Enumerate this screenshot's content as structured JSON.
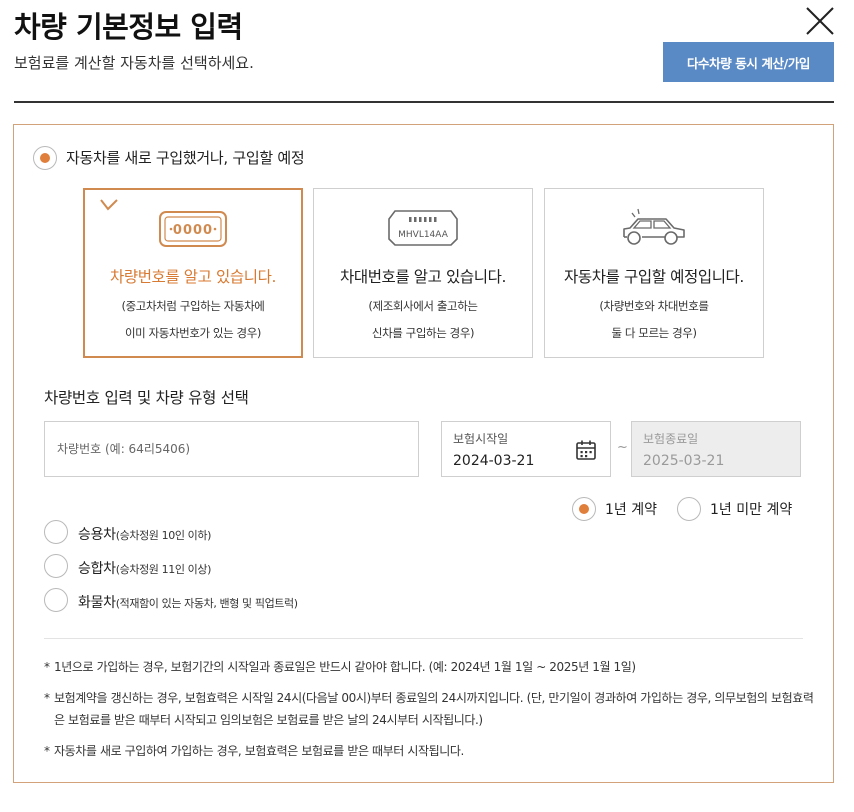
{
  "header": {
    "title": "차량 기본정보 입력",
    "subtitle": "보험료를 계산할 자동차를 선택하세요.",
    "multi_button": "다수차량 동시 계산/가입"
  },
  "purchase_option": {
    "label": "자동차를 새로 구입했거나, 구입할 예정",
    "selected": true
  },
  "cards": [
    {
      "icon": "license-plate-icon",
      "icon_text": "0000",
      "title": "차량번호를 알고 있습니다.",
      "desc_line1": "(중고차처럼 구입하는 자동차에",
      "desc_line2": "이미 자동차번호가 있는 경우)",
      "selected": true
    },
    {
      "icon": "vin-plate-icon",
      "icon_text": "MHVL14AA",
      "title": "차대번호를 알고 있습니다.",
      "desc_line1": "(제조회사에서 출고하는",
      "desc_line2": "신차를 구입하는 경우)",
      "selected": false
    },
    {
      "icon": "car-icon",
      "title": "자동차를 구입할 예정입니다.",
      "desc_line1": "(차량번호와 차대번호를",
      "desc_line2": "둘 다 모르는 경우)",
      "selected": false
    }
  ],
  "input_section": {
    "title": "차량번호 입력 및 차량 유형 선택",
    "plate_placeholder": "차량번호 (예: 64리5406)",
    "plate_value": ""
  },
  "dates": {
    "start_label": "보험시작일",
    "start_value": "2024-03-21",
    "end_label": "보험종료일",
    "end_value": "2025-03-21",
    "separator": "~"
  },
  "contract": {
    "options": [
      "1년 계약",
      "1년 미만 계약"
    ],
    "selected_index": 0
  },
  "vehicle_types": [
    {
      "name": "승용차",
      "note": "(승차정원 10인 이하)"
    },
    {
      "name": "승합차",
      "note": "(승차정원 11인 이상)"
    },
    {
      "name": "화물차",
      "note": "(적재함이 있는 자동차, 밴형 및 픽업트럭)"
    }
  ],
  "notes": [
    "1년으로 가입하는 경우, 보험기간의 시작일과 종료일은 반드시 같아야 합니다. (예: 2024년 1월 1일 ~ 2025년 1월 1일)",
    "보험계약을 갱신하는 경우, 보험효력은 시작일 24시(다음날 00시)부터 종료일의 24시까지입니다. (단, 만기일이 경과하여 가입하는 경우, 의무보험의 보험효력은 보험료를 받은 때부터 시작되고 임의보험은 보험료를 받은 날의 24시부터 시작됩니다.)",
    "자동차를 새로 구입하여 가입하는 경우, 보험효력은 보험료를 받은 때부터 시작됩니다."
  ],
  "colors": {
    "accent": "#d87a32",
    "radio_on": "#e07f3b",
    "button": "#5a8ac6",
    "panel_border": "#d2a27a"
  }
}
